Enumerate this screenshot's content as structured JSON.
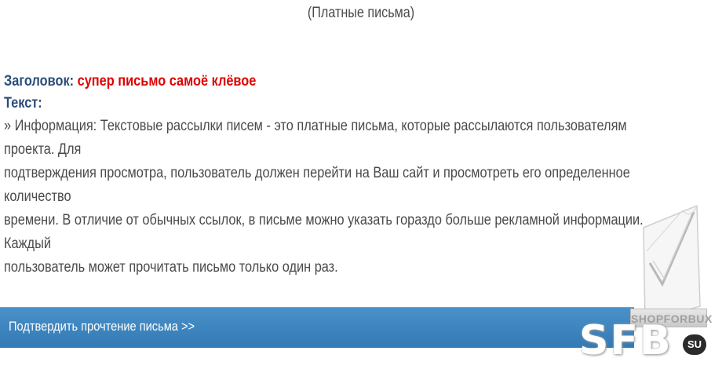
{
  "header": {
    "note": "(Платные письма)"
  },
  "letter": {
    "subject_label": "Заголовок:",
    "subject_value": "супер письмо самоё клёвое",
    "text_label": "Текст:",
    "body_lines": [
      "» Информация: Текстовые рассылки писем - это платные письма, которые рассылаются пользователям проекта. Для",
      "подтверждения просмотра, пользователь должен перейти на Ваш сайт и просмотреть его определенное количество",
      "времени. В отличие от обычных ссылок, в письме можно указать гораздо больше рекламной информации. Каждый",
      "пользователь может прочитать письмо только один раз."
    ]
  },
  "actions": {
    "confirm_label": "Подтвердить прочтение письма >>"
  },
  "badge": {
    "text": "SHOPFORBUX"
  },
  "watermark": {
    "main": "SFB",
    "suffix": "SU"
  },
  "colors": {
    "subject_label": "#2a4d7a",
    "subject_value": "#e00000",
    "body_text": "#4a4a4a",
    "bar_top": "#4a91c9",
    "bar_bottom": "#3379b5"
  },
  "icons": {
    "badge_icon": "checkmark-icon"
  }
}
